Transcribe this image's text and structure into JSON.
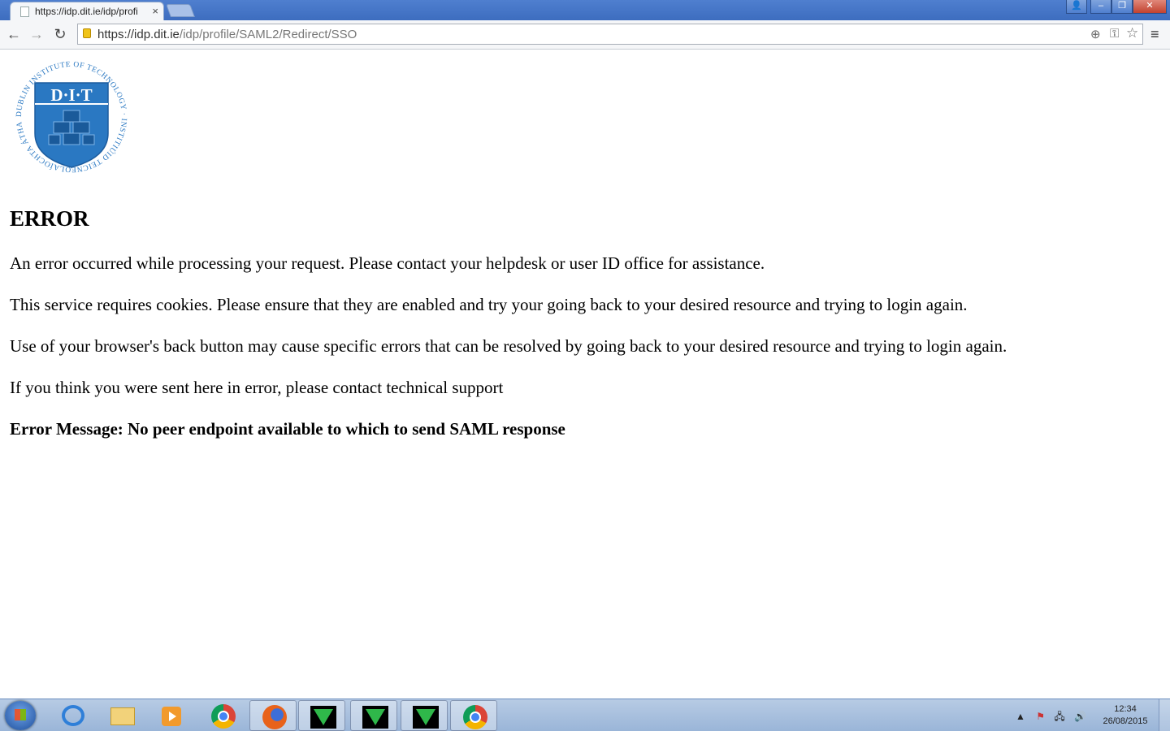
{
  "browser": {
    "tab_title": "https://idp.dit.ie/idp/profi",
    "tab_close": "×",
    "url_host": "https://idp.dit.ie",
    "url_path": "/idp/profile/SAML2/Redirect/SSO"
  },
  "window_controls": {
    "user": "👤",
    "minimize": "–",
    "restore": "❐",
    "close": "✕"
  },
  "page": {
    "logo_text": "D·I·T",
    "logo_ring_text": "DUBLIN INSTITUTE OF TECHNOLOGY · INSTITIÚID TEICNEOLAÍOCHTA ÁTHA CLIATH",
    "heading": "ERROR",
    "para1": "An error occurred while processing your request. Please contact your helpdesk or user ID office for assistance.",
    "para2": "This service requires cookies. Please ensure that they are enabled and try your going back to your desired resource and trying to login again.",
    "para3": "Use of your browser's back button may cause specific errors that can be resolved by going back to your desired resource and trying to login again.",
    "para4": "If you think you were sent here in error, please contact technical support",
    "error_message": "Error Message: No peer endpoint available to which to send SAML response"
  },
  "taskbar": {
    "time": "12:34",
    "date": "26/08/2015"
  }
}
